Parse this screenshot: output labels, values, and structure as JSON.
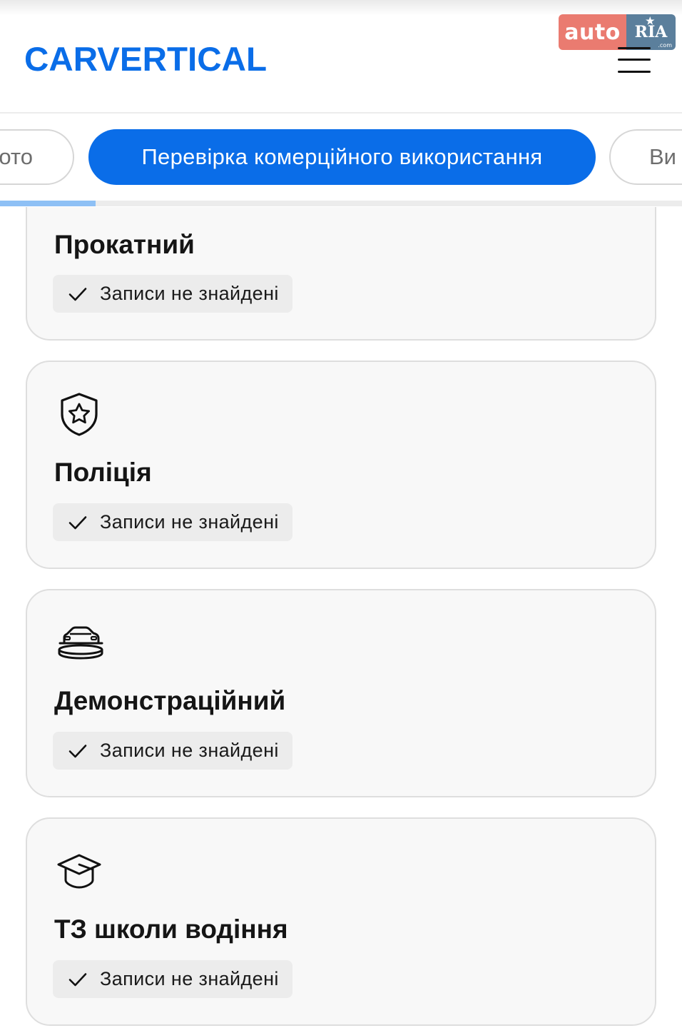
{
  "header": {
    "logo_text": "CARVERTICAL",
    "watermark": {
      "auto": "auto",
      "ria": "RIA",
      "com": ".com"
    },
    "menu_icon": "hamburger-menu-icon"
  },
  "tabs": {
    "items": [
      {
        "label": "Фото",
        "visible_text": "ото",
        "active": false
      },
      {
        "label": "Перевірка комерційного використання",
        "active": true
      },
      {
        "label": "Ви",
        "visible_text": "Ви",
        "active": false
      }
    ],
    "progress": 0.14
  },
  "cards": [
    {
      "title": "Прокатний",
      "icon": null,
      "status": "Записи не знайдені",
      "status_icon": "check-icon"
    },
    {
      "title": "Поліція",
      "icon": "police-shield-star-icon",
      "status": "Записи не знайдені",
      "status_icon": "check-icon"
    },
    {
      "title": "Демонстраційний",
      "icon": "car-on-platform-icon",
      "status": "Записи не знайдені",
      "status_icon": "check-icon"
    },
    {
      "title": "ТЗ школи водіння",
      "icon": "graduation-cap-icon",
      "status": "Записи не знайдені",
      "status_icon": "check-icon"
    }
  ],
  "colors": {
    "brand_blue": "#0a6de8",
    "card_bg": "#f8f8f8",
    "chip_bg": "#ececec"
  }
}
